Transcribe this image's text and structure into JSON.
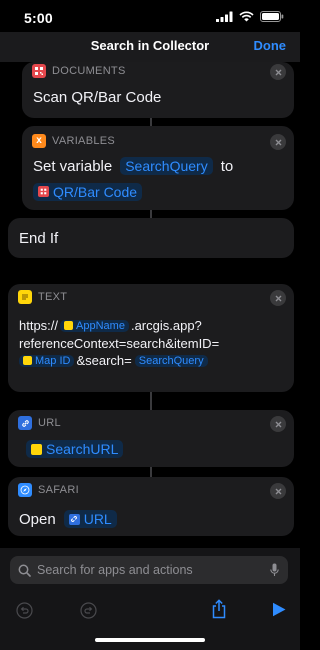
{
  "status": {
    "time": "5:00"
  },
  "nav": {
    "title": "Search in Collector",
    "done_label": "Done"
  },
  "blocks": {
    "documents": {
      "header": "DOCUMENTS",
      "action": "Scan QR/Bar Code"
    },
    "variables": {
      "header": "VARIABLES",
      "prefix": "Set variable",
      "variable_token": "SearchQuery",
      "to_word": "to",
      "value_token": "QR/Bar Code"
    },
    "end_if": {
      "label": "End If"
    },
    "text": {
      "header": "TEXT",
      "line1_prefix": "https://",
      "token_app_name": "AppName",
      "line1_suffix": ".arcgis.app?",
      "line2": "referenceContext=search&itemID=",
      "token_map_id": "Map ID",
      "line3_mid": "&search=",
      "token_search_query": "SearchQuery"
    },
    "url": {
      "header": "URL",
      "token": "SearchURL"
    },
    "safari": {
      "header": "SAFARI",
      "prefix": "Open",
      "token": "URL"
    }
  },
  "search": {
    "placeholder": "Search for apps and actions"
  },
  "colors": {
    "background": "#000000",
    "card": "#1c1c1e",
    "accent_blue": "#2f8cff",
    "documents_icon": "#e5484d",
    "variables_icon": "#ff8a1c",
    "text_icon": "#ffd60a",
    "url_icon": "#2f6fde",
    "safari_icon": "#2f8cff"
  },
  "icons": [
    "signal-icon",
    "wifi-icon",
    "battery-icon",
    "documents-app-icon",
    "variables-app-icon",
    "text-app-icon",
    "url-app-icon",
    "safari-app-icon",
    "close-icon",
    "search-icon",
    "microphone-icon",
    "undo-icon",
    "redo-icon",
    "share-icon",
    "play-icon"
  ]
}
